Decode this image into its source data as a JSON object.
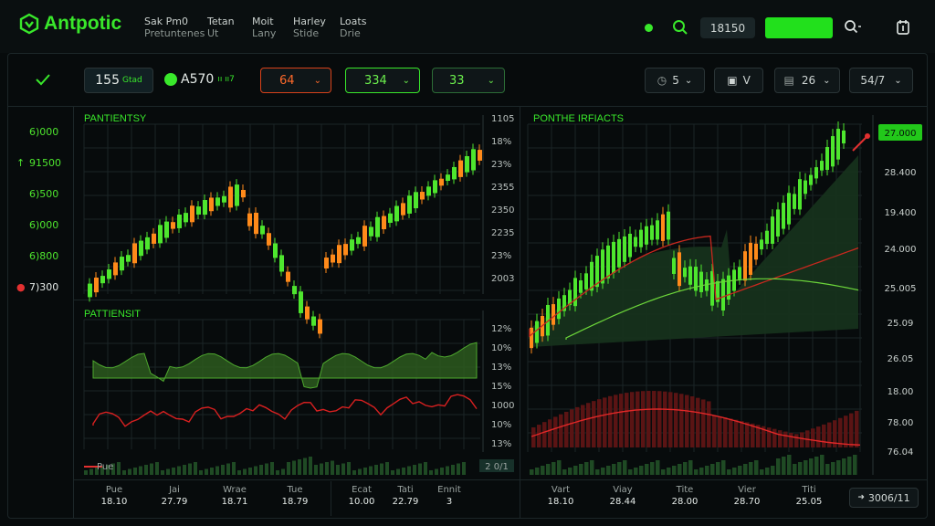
{
  "app": {
    "title": "Antpotic"
  },
  "menu": [
    {
      "label": "Sak Pm0",
      "sub": "Pretuntenes"
    },
    {
      "label": "Tetan",
      "sub": "Ut"
    },
    {
      "label": "Moit",
      "sub": "Lany"
    },
    {
      "label": "Harley",
      "sub": "Stide"
    },
    {
      "label": "Loats",
      "sub": "Drie"
    }
  ],
  "header": {
    "price_box": "18150",
    "search_icon": "search-icon",
    "settings_icon": "gear-icon"
  },
  "toolbar": {
    "stat1_value": "155",
    "stat1_sub": "Gtad",
    "stat2_value": "A570",
    "stat2_sub": "ıı ıı7",
    "drop1": "64",
    "drop2": "334",
    "drop3": "33",
    "ctrl1": "5",
    "ctrl2": "V",
    "ctrl3": "26",
    "ctrl4": "54/7"
  },
  "sidebar": {
    "check_icon": "check-icon",
    "values": [
      {
        "text": "6)000",
        "marker": ""
      },
      {
        "text": "91500",
        "marker": "↑"
      },
      {
        "text": "6)500",
        "marker": ""
      },
      {
        "text": "6)000",
        "marker": ""
      },
      {
        "text": "6)800",
        "marker": ""
      },
      {
        "text": "7)300",
        "marker": "●"
      }
    ]
  },
  "left_chart": {
    "title": "PANTIENTSY",
    "yticks": [
      "1105",
      "18%",
      "23%",
      "2355",
      "2350",
      "2235",
      "23%",
      "2003"
    ],
    "sub_title": "PATTIENSIT",
    "sub_yticks": [
      "12%",
      "10%",
      "13%",
      "15%",
      "1000",
      "10%",
      "13%"
    ],
    "legend_label": "Pue",
    "volume_badge": "2 0/1",
    "footer": [
      {
        "label": "Pue",
        "value": "18.10"
      },
      {
        "label": "Jai",
        "value": "27.79"
      },
      {
        "label": "Wrae",
        "value": "18.71"
      },
      {
        "label": "Tue",
        "value": "18.79"
      }
    ],
    "footer2": [
      {
        "label": "Ecat",
        "value": "10.00"
      },
      {
        "label": "Tati",
        "value": "22.79"
      },
      {
        "label": "Ennit",
        "value": "3"
      }
    ]
  },
  "right_chart": {
    "title": "PONTHE IRFIACTS",
    "yticks": [
      "27.000",
      "28.400",
      "19.400",
      "24.000",
      "25.005",
      "25.09",
      "26.05",
      "18.00",
      "78.00",
      "76.04"
    ],
    "footer": [
      {
        "label": "Vart",
        "value": "18.10"
      },
      {
        "label": "Viay",
        "value": "28.44"
      },
      {
        "label": "Tite",
        "value": "28.00"
      },
      {
        "label": "Vier",
        "value": "28.70"
      },
      {
        "label": "Titi",
        "value": "25.05"
      }
    ],
    "corner_button": "3006/11"
  },
  "colors": {
    "up": "#4ee62e",
    "down": "#ff8a1a",
    "accent": "#39e82b",
    "red": "#e23030",
    "bg": "#070b0c"
  }
}
